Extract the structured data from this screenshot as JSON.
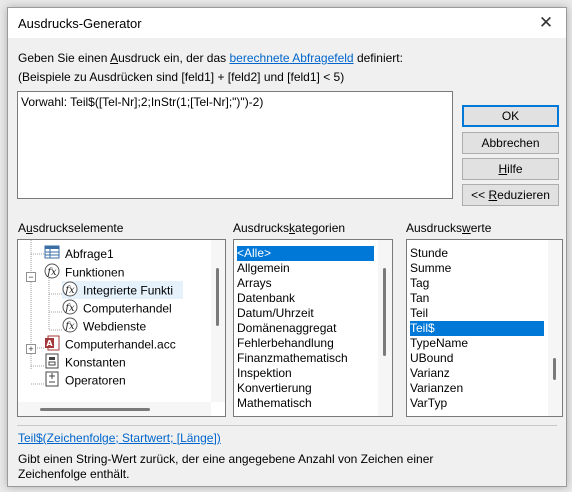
{
  "window": {
    "title": "Ausdrucks-Generator",
    "close_glyph": "✕"
  },
  "description": {
    "line1_prefix": "Geben Sie einen ",
    "line1_underlined": "A",
    "line1_mid": "usdruck ein, der das ",
    "line1_link": "berechnete Abfragefeld",
    "line1_suffix": " definiert:",
    "line2": "(Beispiele zu Ausdrücken sind [feld1] + [feld2] und [feld1] < 5)"
  },
  "expression": {
    "value": "Vorwahl: Teil$([Tel-Nr];2;InStr(1;[Tel-Nr];\")\")-2)"
  },
  "buttons": {
    "ok": "OK",
    "cancel": "Abbrechen",
    "help_ul": "H",
    "help_rest": "ilfe",
    "reduce_pre": "<< ",
    "reduce_ul": "R",
    "reduce_rest": "eduzieren"
  },
  "sections": {
    "elements": {
      "pre": "A",
      "ul": "u",
      "post": "sdruckselemente"
    },
    "categories": {
      "pre": "Ausdrucks",
      "ul": "k",
      "post": "ategorien"
    },
    "values": {
      "pre": "Ausdrucks",
      "ul": "w",
      "post": "erte"
    }
  },
  "tree": [
    {
      "label": "Abfrage1",
      "icon": "query-icon"
    },
    {
      "label": "Funktionen",
      "icon": "function-icon",
      "expander": "−"
    },
    {
      "label": "Integrierte Funkti",
      "icon": "function-icon",
      "selected_bg": true
    },
    {
      "label": "Computerhandel",
      "icon": "function-icon"
    },
    {
      "label": "Webdienste",
      "icon": "function-icon"
    },
    {
      "label": "Computerhandel.acc",
      "icon": "access-database-icon",
      "expander": "+"
    },
    {
      "label": "Konstanten",
      "icon": "constants-icon"
    },
    {
      "label": "Operatoren",
      "icon": "operators-icon"
    }
  ],
  "categories": [
    "<Alle>",
    "Allgemein",
    "Arrays",
    "Datenbank",
    "Datum/Uhrzeit",
    "Domänenaggregat",
    "Fehlerbehandlung",
    "Finanzmathematisch",
    "Inspektion",
    "Konvertierung",
    "Mathematisch"
  ],
  "categories_selected": 0,
  "values": [
    "Stunde",
    "Summe",
    "Tag",
    "Tan",
    "Teil",
    "Teil$",
    "TypeName",
    "UBound",
    "Varianz",
    "Varianzen",
    "VarTyp"
  ],
  "values_selected": 5,
  "syntax": "Teil$(Zeichenfolge; Startwert; [Länge])",
  "help": {
    "line1": "Gibt einen String-Wert zurück, der eine angegebene Anzahl von Zeichen einer",
    "line2": "Zeichenfolge enthält."
  },
  "colors": {
    "selection": "#0078d7",
    "link": "#0066cc",
    "dialog_bg": "#f0f0f0"
  }
}
